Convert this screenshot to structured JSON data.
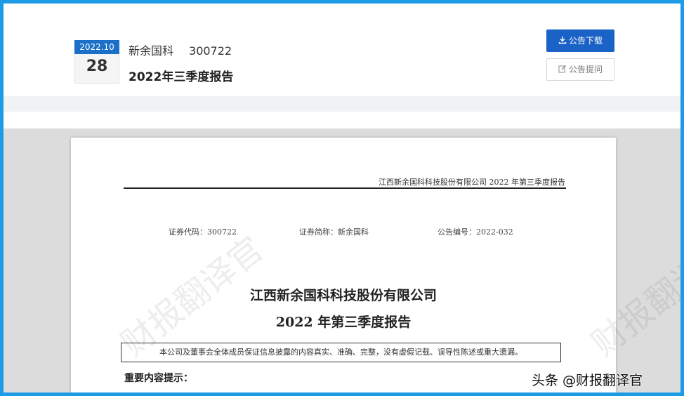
{
  "header": {
    "date_ym": "2022.10",
    "date_day": "28",
    "company_name": "新余国科",
    "stock_code": "300722",
    "report_title": "2022年三季度报告",
    "download_label": "公告下载",
    "ask_label": "公告提问",
    "download_icon": "download-icon",
    "ask_icon": "edit-icon"
  },
  "document": {
    "running_head": "江西新余国科科技股份有限公司 2022 年第三季度报告",
    "security_code": "证券代码：300722",
    "security_abbr": "证券简称：新余国科",
    "announcement_no": "公告编号：2022-032",
    "company_full": "江西新余国科科技股份有限公司",
    "title": "2022 年第三季度报告",
    "notice": "本公司及董事会全体成员保证信息披露的内容真实、准确、完整，没有虚假记载、误导性陈述或重大遗漏。",
    "important": "重要内容提示："
  },
  "watermark": "财报翻译官",
  "credit": "头条 @财报翻译官",
  "colors": {
    "frame_border": "#1e9be6",
    "primary_button": "#1a62c6",
    "date_badge": "#1a6fc9"
  }
}
